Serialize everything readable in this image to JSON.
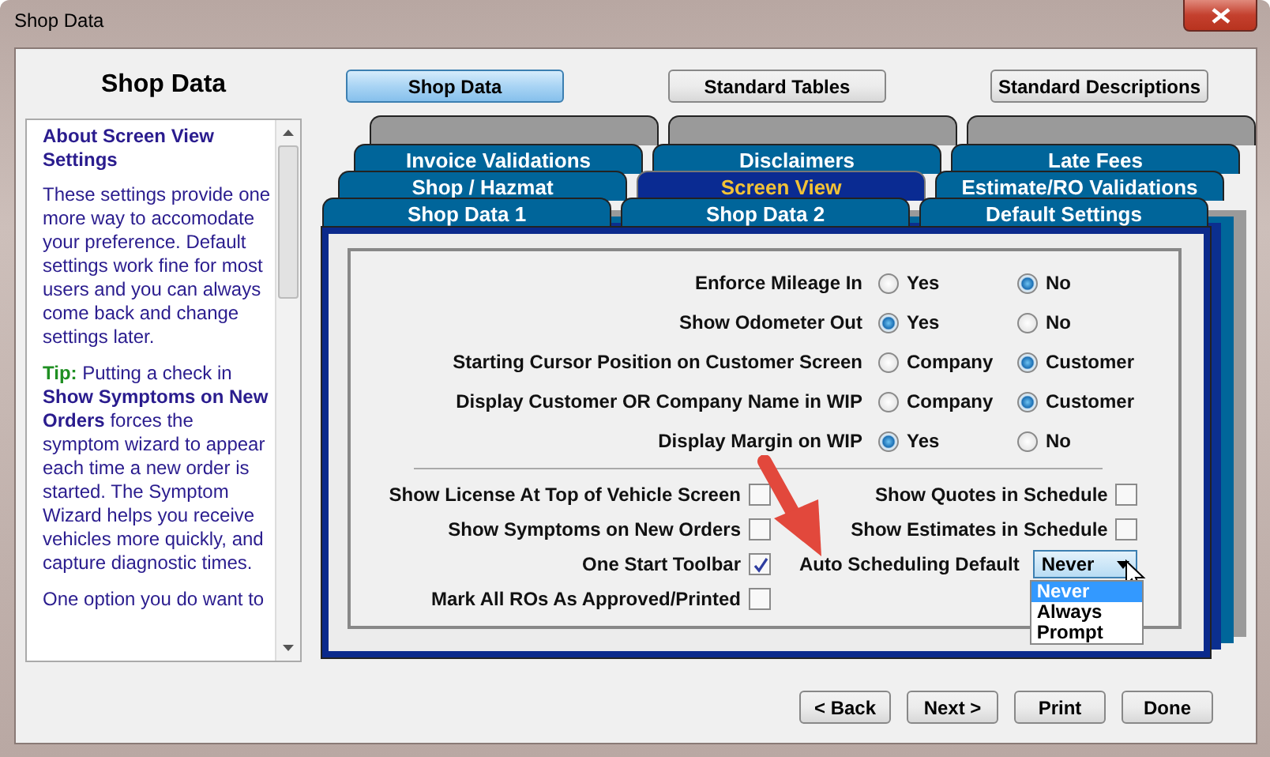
{
  "window": {
    "title": "Shop Data"
  },
  "sidebar": {
    "title": "Shop Data",
    "heading": "About Screen View Settings",
    "paragraphs": [
      {
        "kind": "text",
        "text": "These settings provide one more way to accomodate your preference. Default settings work fine for most users and you can always come back and change settings later."
      },
      {
        "kind": "tip",
        "label": "Tip:",
        "text": "Putting a check in **Show Symptoms on New Orders** forces the symptom wizard to appear each time a new order is started. The Symptom Wizard helps you receive vehicles more quickly, and capture diagnostic times."
      },
      {
        "kind": "text",
        "text": "One option you do want to"
      }
    ]
  },
  "top_buttons": [
    {
      "label": "Shop Data",
      "selected": true
    },
    {
      "label": "Standard Tables",
      "selected": false
    },
    {
      "label": "Standard Descriptions",
      "selected": false
    }
  ],
  "tab_rows": [
    [
      {
        "label": "Invoice Validations",
        "selected": false
      },
      {
        "label": "Disclaimers",
        "selected": false
      },
      {
        "label": "Late Fees",
        "selected": false
      }
    ],
    [
      {
        "label": "Shop / Hazmat",
        "selected": false
      },
      {
        "label": "Screen View",
        "selected": true
      },
      {
        "label": "Estimate/RO Validations",
        "selected": false
      }
    ],
    [
      {
        "label": "Shop Data 1",
        "selected": false
      },
      {
        "label": "Shop Data 2",
        "selected": false
      },
      {
        "label": "Default Settings",
        "selected": false
      }
    ]
  ],
  "radio_settings": [
    {
      "label": "Enforce Mileage In",
      "options": [
        {
          "label": "Yes",
          "selected": false
        },
        {
          "label": "No",
          "selected": true
        }
      ]
    },
    {
      "label": "Show Odometer Out",
      "options": [
        {
          "label": "Yes",
          "selected": true
        },
        {
          "label": "No",
          "selected": false
        }
      ]
    },
    {
      "label": "Starting Cursor Position on Customer Screen",
      "options": [
        {
          "label": "Company",
          "selected": false
        },
        {
          "label": "Customer",
          "selected": true
        }
      ]
    },
    {
      "label": "Display Customer OR Company Name in WIP",
      "options": [
        {
          "label": "Company",
          "selected": false
        },
        {
          "label": "Customer",
          "selected": true
        }
      ]
    },
    {
      "label": "Display Margin on WIP",
      "options": [
        {
          "label": "Yes",
          "selected": true
        },
        {
          "label": "No",
          "selected": false
        }
      ]
    }
  ],
  "checkbox_settings": [
    {
      "label": "Show License At Top of Vehicle Screen",
      "checked": false
    },
    {
      "label": "Show Symptoms on New Orders",
      "checked": false
    },
    {
      "label": "One Start Toolbar",
      "checked": true
    },
    {
      "label": "Mark All ROs As Approved/Printed",
      "checked": false
    }
  ],
  "schedule_settings": [
    {
      "kind": "checkbox",
      "label": "Show Quotes in Schedule",
      "checked": false
    },
    {
      "kind": "checkbox",
      "label": "Show Estimates in Schedule",
      "checked": false
    },
    {
      "kind": "dropdown",
      "label": "Auto Scheduling Default",
      "value": "Never",
      "expanded": true,
      "options": [
        {
          "label": "Never",
          "selected": true
        },
        {
          "label": "Always",
          "selected": false
        },
        {
          "label": "Prompt",
          "selected": false
        }
      ]
    }
  ],
  "buttons": [
    "< Back",
    "Next >",
    "Print",
    "Done"
  ]
}
